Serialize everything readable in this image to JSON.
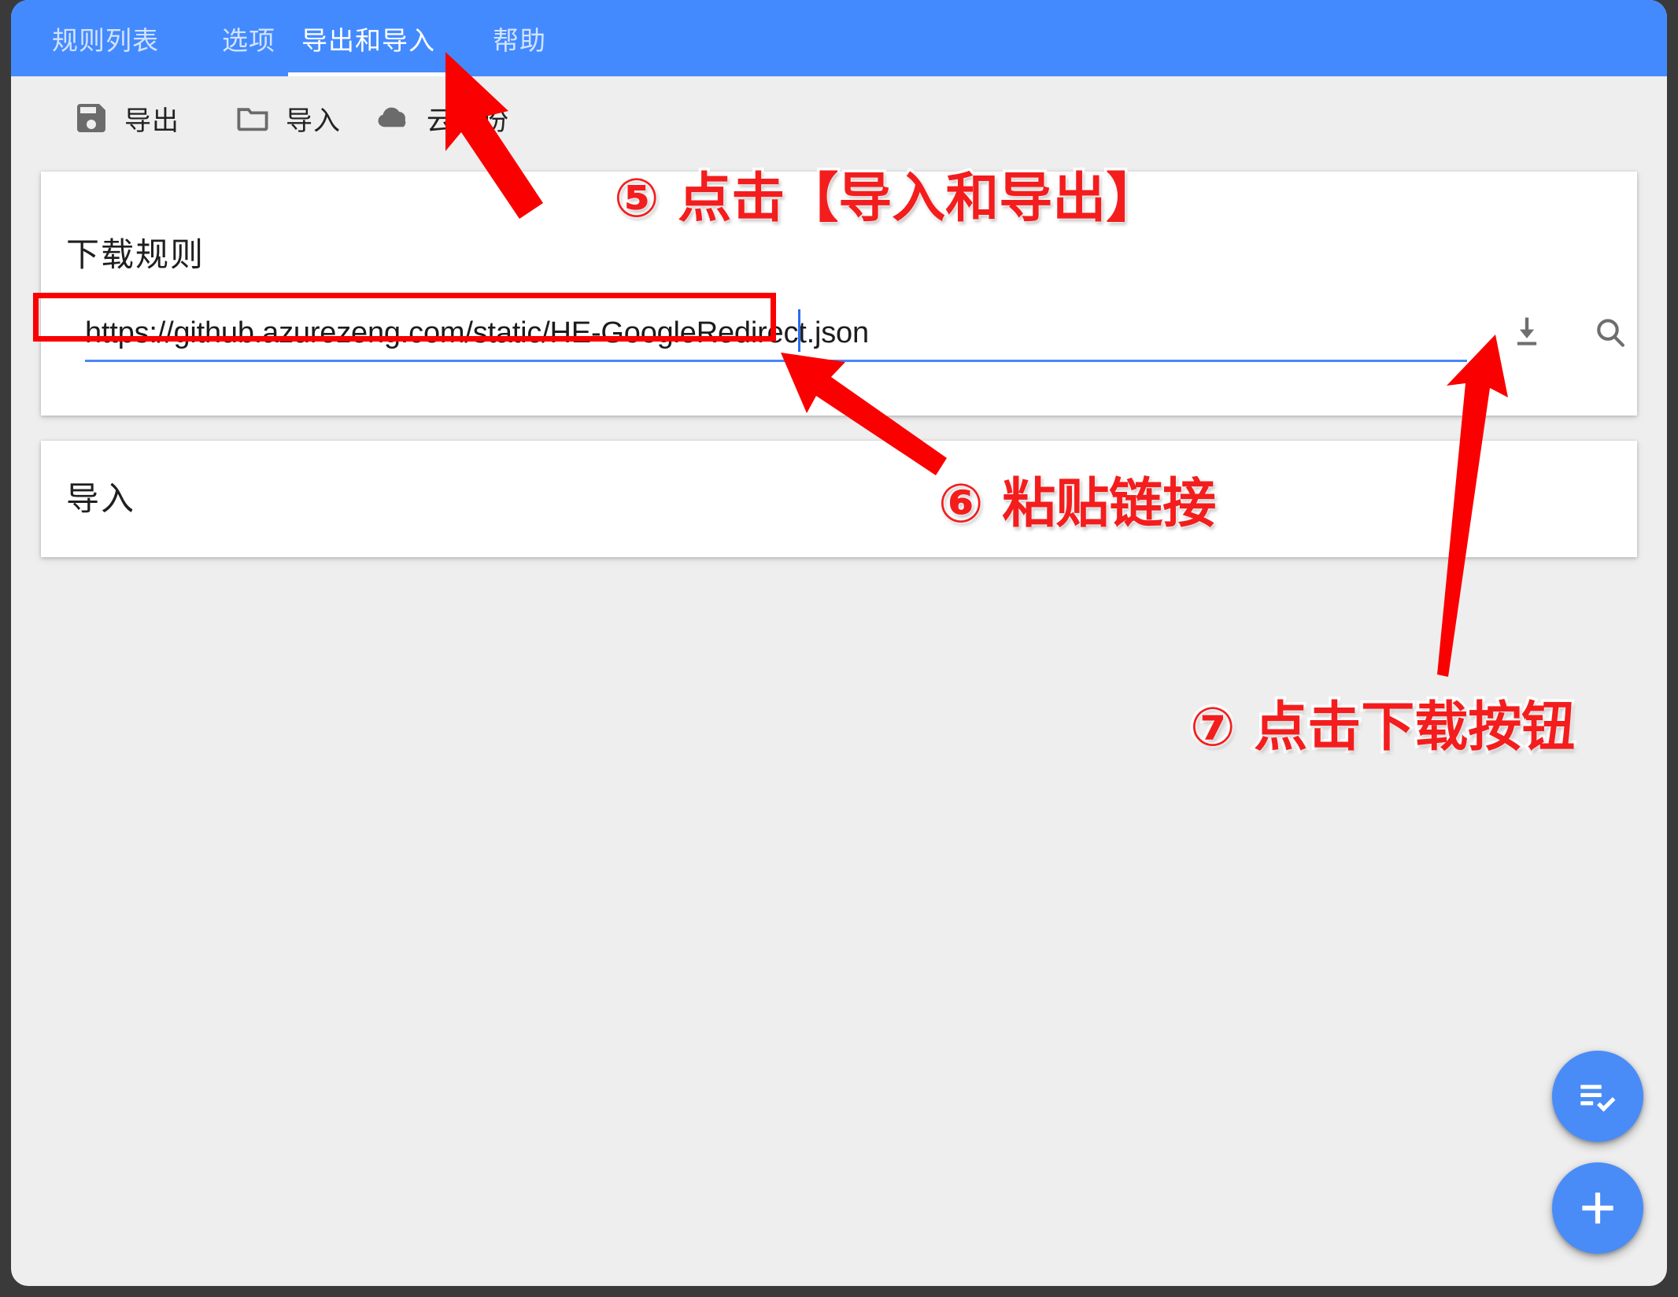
{
  "app": {
    "accent_blue": "#448aff",
    "annotation_red": "#f41d1d",
    "page_background": "#eeeeee"
  },
  "tabs": [
    {
      "label": "规则列表",
      "active": false
    },
    {
      "label": "选项",
      "active": false
    },
    {
      "label": "导出和导入",
      "active": true
    },
    {
      "label": "帮助",
      "active": false
    }
  ],
  "toolbar": {
    "export_label": "导出",
    "export_icon": "save-floppy-icon",
    "import_label": "导入",
    "import_icon": "folder-icon",
    "cloud_backup_label": "云备份",
    "cloud_backup_icon": "cloud-icon"
  },
  "download_card": {
    "title": "下载规则",
    "url_value": "https://github.azurezeng.com/static/HE-GoogleRedirect.json",
    "url_placeholder": "",
    "download_icon": "download-icon",
    "search_icon": "search-icon"
  },
  "import_card": {
    "title": "导入"
  },
  "fabs": [
    {
      "name": "playlist-check-fab",
      "icon": "playlist-check-icon"
    },
    {
      "name": "add-fab",
      "icon": "plus-icon"
    }
  ],
  "annotations": [
    {
      "id": "step5",
      "text": "⑤ 点击【导入和导出】"
    },
    {
      "id": "step6",
      "text": "⑥ 粘贴链接"
    },
    {
      "id": "step7",
      "text": "⑦ 点击下载按钮"
    }
  ]
}
